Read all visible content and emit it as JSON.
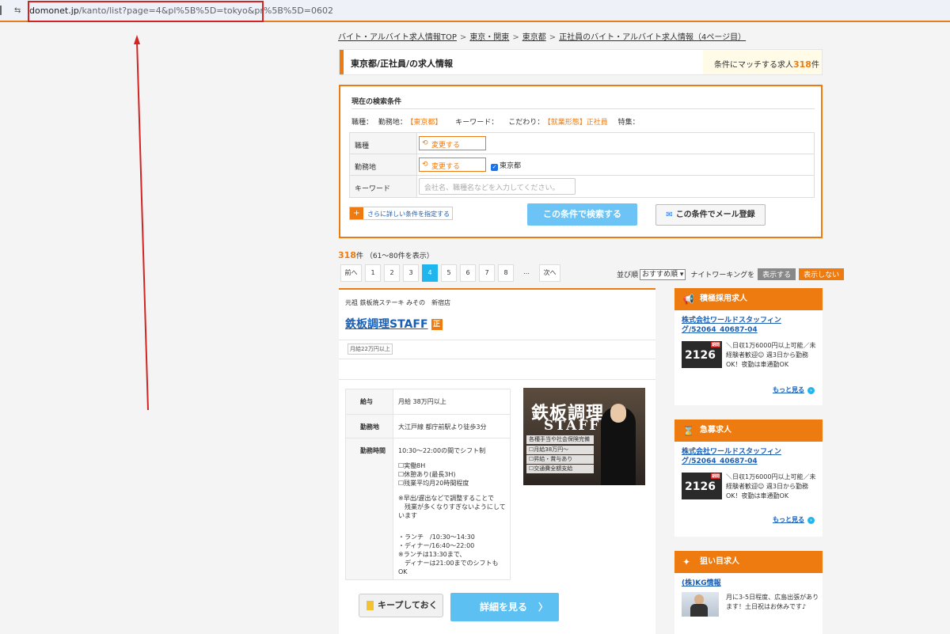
{
  "browser": {
    "url_host": "domonet.jp",
    "url_path": "/kanto/list?page=4&pl%5B%5D=tokyo&pr%5B%5D=0602"
  },
  "breadcrumb": [
    "バイト・アルバイト求人情報TOP",
    "東京・関東",
    "東京都",
    "正社員のバイト・アルバイト求人情報（4ページ目）"
  ],
  "header": {
    "title": "東京都/正社員/の求人情報",
    "count_prefix": "条件にマッチする求人",
    "count_num": "318",
    "count_suffix": "件"
  },
  "search": {
    "title": "現在の検索条件",
    "cond_job_label": "職種：",
    "cond_area_label": "勤務地：",
    "cond_area_value": "【東京都】",
    "cond_keyword_label": "キーワード：",
    "cond_pref_label": "こだわり：",
    "cond_pref_value": "【就業形態】正社員",
    "cond_special_label": "特集：",
    "row_job": "職種",
    "row_area": "勤務地",
    "row_keyword": "キーワード",
    "change_label": "変更する",
    "area_checkbox": "東京都",
    "keyword_placeholder": "会社名、職種名などを入力してください。",
    "detail_btn": "さらに詳しい条件を指定する",
    "search_btn": "この条件で検索する",
    "mail_btn": "この条件でメール登録"
  },
  "results": {
    "count": "318",
    "count_unit": "件",
    "range": "（61〜80件を表示）"
  },
  "pager": {
    "prev": "前へ",
    "pages": [
      "1",
      "2",
      "3",
      "4",
      "5",
      "6",
      "7",
      "8"
    ],
    "current": "4",
    "dots": "…",
    "next": "次へ"
  },
  "sort": {
    "label": "並び順",
    "selected": "おすすめ順",
    "night_label": "ナイトワーキングを",
    "show": "表示する",
    "hide": "表示しない"
  },
  "job": {
    "company": "元祖 鉄板焼ステーキ みその　新宿店",
    "title": "鉄板調理STAFF",
    "badge": "正",
    "tag": "月給22万円以上",
    "salary_label": "給与",
    "salary": "月給 38万円以上",
    "place_label": "勤務地",
    "place": "大江戸線 都庁前駅より徒歩3分",
    "hours_label": "勤務時間",
    "hours": [
      "10:30〜22:00の間でシフト制",
      "",
      "☐実働8H",
      "☐休憩あり(最長3H)",
      "☐残業平均月20時間程度",
      "",
      "※早出/遅出などで調整することで",
      "　残業が多くなりすぎないようにして",
      "います",
      "",
      "",
      "・ランチ　/10:30〜14:30",
      "・ディナー/16:40〜22:00",
      "※ランチは13:30まで、",
      "　ディナーは21:00までのシフトもOK"
    ],
    "image": {
      "t1": "鉄板調理",
      "t2": "STAFF",
      "l1": "各種手当や社会保険完備",
      "l2": "☐月給38万円〜",
      "l3": "☐昇給・賞与あり",
      "l4": "☐交通費全額支給"
    },
    "keep_btn": "キープしておく",
    "more_btn": "詳細を見る",
    "more_arrow": "〉"
  },
  "sidebar": [
    {
      "head": "積極採用求人",
      "icon": "megaphone-icon",
      "link": "株式会社ワールドスタッフィング/52064_40687-04",
      "thumb_big": "2126",
      "thumb_tag": "期間",
      "desc": "＼日収1万6000円以上可能／未経験者歓迎☺ 週3日から勤務OK！夜勤は車通勤OK",
      "more": "もっと見る"
    },
    {
      "head": "急募求人",
      "icon": "hourglass-icon",
      "link": "株式会社ワールドスタッフィング/52064_40687-04",
      "thumb_big": "2126",
      "thumb_tag": "期間",
      "desc": "＼日収1万6000円以上可能／未経験者歓迎☺ 週3日から勤務OK！夜勤は車通勤OK",
      "more": "もっと見る"
    },
    {
      "head": "狙い目求人",
      "icon": "sparkle-icon",
      "link": "(株)KG情報",
      "desc": "月に3-5日程度、広島出張があります！土日祝はお休みです♪"
    }
  ]
}
